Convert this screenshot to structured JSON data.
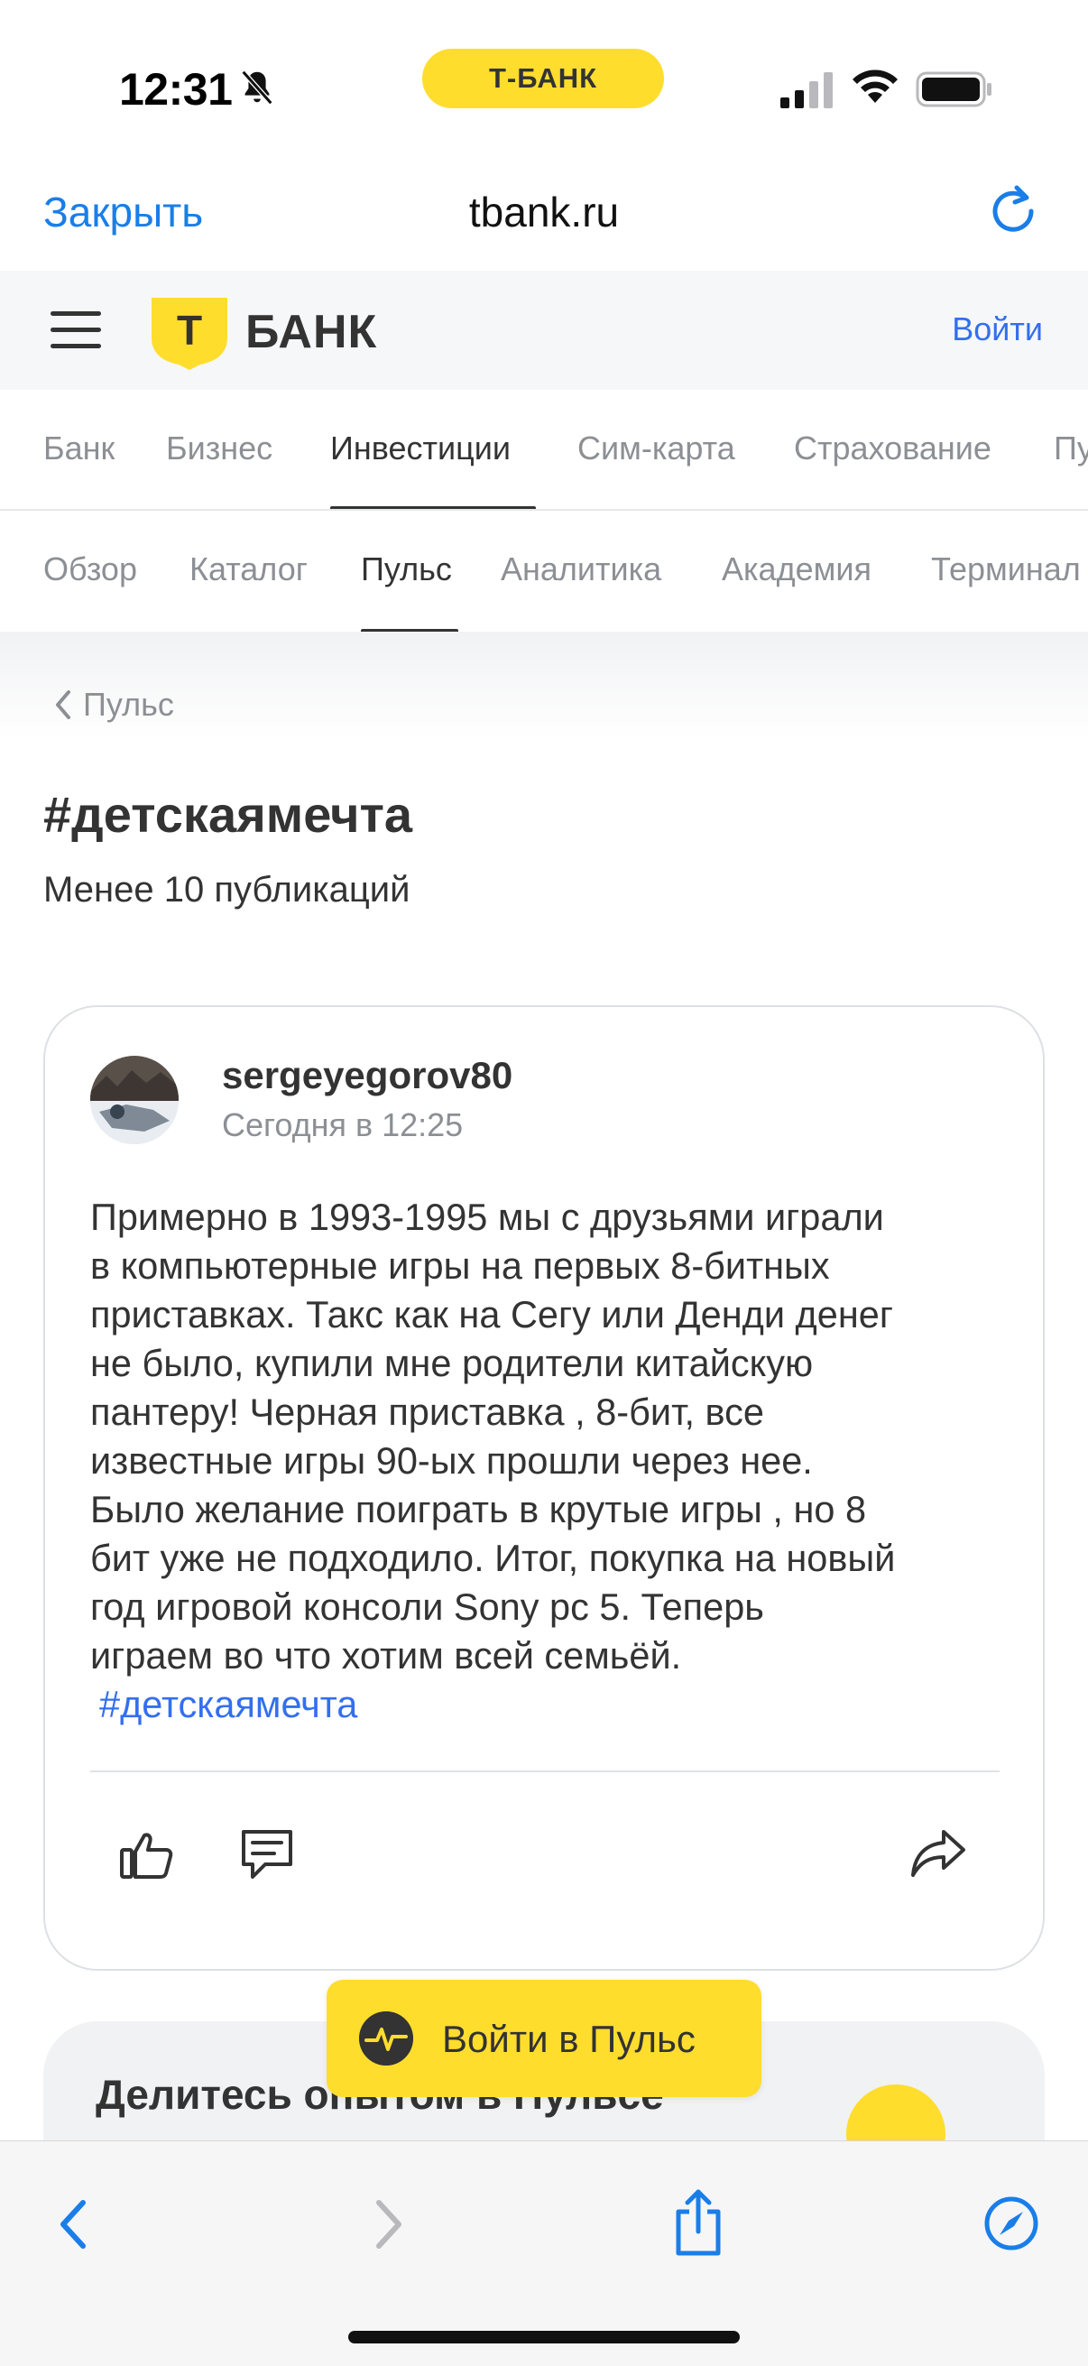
{
  "status_bar": {
    "time": "12:31",
    "brand_pill": "Т-БАНК"
  },
  "browser": {
    "close_label": "Закрыть",
    "domain": "tbank.ru"
  },
  "header": {
    "logo_text": "БАНК",
    "logo_letter": "Т",
    "login_label": "Войти"
  },
  "main_tabs": [
    "Банк",
    "Бизнес",
    "Инвестиции",
    "Сим-карта",
    "Страхование",
    "Пу"
  ],
  "main_tabs_active": "Инвестиции",
  "sub_tabs": [
    "Обзор",
    "Каталог",
    "Пульс",
    "Аналитика",
    "Академия",
    "Терминал"
  ],
  "sub_tabs_active": "Пульс",
  "page": {
    "back_label": "Пульс",
    "title": "#детскаямечта",
    "pub_count": "Менее 10 публикаций"
  },
  "post": {
    "author": "sergeyegorov80",
    "time": "Сегодня в 12:25",
    "lines": [
      "Примерно в 1993-1995 мы с друзьями играли",
      "в компьютерные игры на первых 8-битных",
      "приставках. Такс как на Сегу или Денди денег",
      "не было, купили мне родители китайскую",
      "пантеру! Черная приставка , 8-бит, все",
      "известные игры 90-ых  прошли через нее.",
      "Было желание поиграть в крутые игры , но 8",
      "бит уже не подходило. Итог, покупка на новый",
      "год игровой консоли Sony pc 5. Теперь",
      "играем во что хотим всей семьёй."
    ],
    "tag": "#детскаямечта"
  },
  "promo": {
    "title": "Делитесь опытом в Пульсе"
  },
  "pulse_button": {
    "label": "Войти в Пульс"
  },
  "colors": {
    "brand_yellow": "#ffdd2d",
    "link_blue": "#336fee",
    "safari_blue": "#1a7ee8"
  }
}
